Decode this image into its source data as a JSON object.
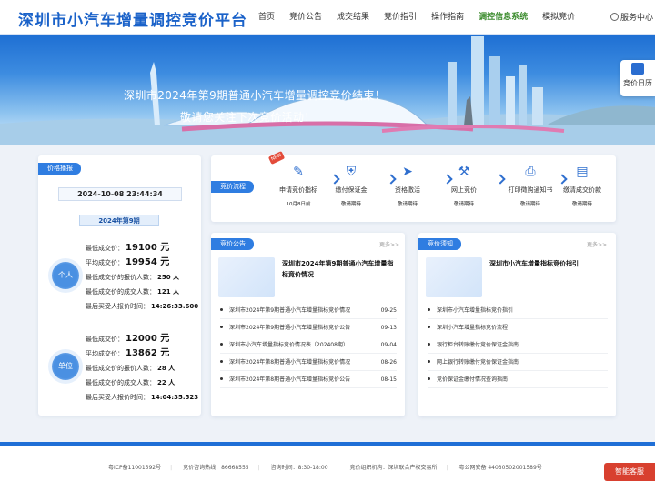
{
  "header": {
    "title": "深圳市小汽车增量调控竞价平台",
    "nav": [
      "首页",
      "竞价公告",
      "成交结果",
      "竞价指引",
      "操作指南",
      "调控信息系统",
      "模拟竞价"
    ],
    "service": "服务中心"
  },
  "banner": {
    "line1": "深圳市2024年第9期普通小汽车增量调控竞价结束！",
    "line2": "敬请您关注下次竞价活动！",
    "calendar": "竞价日历"
  },
  "price": {
    "tag": "价格播报",
    "datetime": "2024-10-08 23:44:34",
    "period": "2024年第9期",
    "personal": {
      "label": "个人",
      "rows": [
        {
          "k": "最低成交价：",
          "v": "19100 元"
        },
        {
          "k": "平均成交价：",
          "v": "19954 元"
        },
        {
          "k": "最低成交价的报价人数：",
          "v": "250 人"
        },
        {
          "k": "最低成交价的成交人数：",
          "v": "121 人"
        },
        {
          "k": "最后买受人报价时间：",
          "v": "14:26:33.600"
        }
      ]
    },
    "company": {
      "label": "单位",
      "rows": [
        {
          "k": "最低成交价：",
          "v": "12000 元"
        },
        {
          "k": "平均成交价：",
          "v": "13862 元"
        },
        {
          "k": "最低成交价的报价人数：",
          "v": "28 人"
        },
        {
          "k": "最低成交价的成交人数：",
          "v": "22 人"
        },
        {
          "k": "最后买受人报价时间：",
          "v": "14:04:35.523"
        }
      ]
    }
  },
  "process": {
    "tag": "竞价流程",
    "hot": "NEW",
    "steps": [
      {
        "name": "申请竞价指标",
        "sub": "10月8日前",
        "icon": "form-icon"
      },
      {
        "name": "缴付保证金",
        "sub": "敬请期待",
        "icon": "shield-icon"
      },
      {
        "name": "资格激活",
        "sub": "敬请期待",
        "icon": "cursor-icon"
      },
      {
        "name": "网上竞价",
        "sub": "敬请期待",
        "icon": "gavel-icon"
      },
      {
        "name": "打印徵购通知书",
        "sub": "敬请期待",
        "icon": "printer-icon"
      },
      {
        "name": "缴清成交价款",
        "sub": "敬请期待",
        "icon": "document-icon"
      }
    ]
  },
  "notice": {
    "tag": "竞价公告",
    "more": "更多>>",
    "feature": "深圳市2024年第9期普通小汽车增量指标竞价情况",
    "items": [
      {
        "t": "深圳市2024年第9期普通小汽车增量指标竞价情况",
        "d": "09-25"
      },
      {
        "t": "深圳市2024年第9期普通小汽车增量指标竞价公告",
        "d": "09-13"
      },
      {
        "t": "深圳市小汽车增量指标竞价情况表（202408期）",
        "d": "09-04"
      },
      {
        "t": "深圳市2024年第8期普通小汽车增量指标竞价情况",
        "d": "08-26"
      },
      {
        "t": "深圳市2024年第8期普通小汽车增量指标竞价公告",
        "d": "08-15"
      }
    ]
  },
  "know": {
    "tag": "竞价须知",
    "more": "更多>>",
    "feature": "深圳市小汽车增量指标竞价指引",
    "items": [
      {
        "t": "深圳市小汽车增量指标竞价指引"
      },
      {
        "t": "深圳小汽车增量指标竞价流程"
      },
      {
        "t": "银行柜台转账缴付竞价保证金指南"
      },
      {
        "t": "网上银行转账缴付竞价保证金指南"
      },
      {
        "t": "竞价保证金缴付情况查询指南"
      }
    ]
  },
  "footer": {
    "icp": "粤ICP备11001592号",
    "hotline": "竞价咨询热线：86668555",
    "hours": "咨询时间：8:30-18:00",
    "org": "竞价组织机构：深圳联合产权交易所",
    "police": "粤公网安备 44030502001589号"
  },
  "chat": "智能客服",
  "colors": {
    "brand": "#1a62c9",
    "accent": "#2f7de1",
    "active_nav": "#3a8b2c",
    "footer_bar": "#1f6fd6",
    "chat": "#d8402f"
  }
}
